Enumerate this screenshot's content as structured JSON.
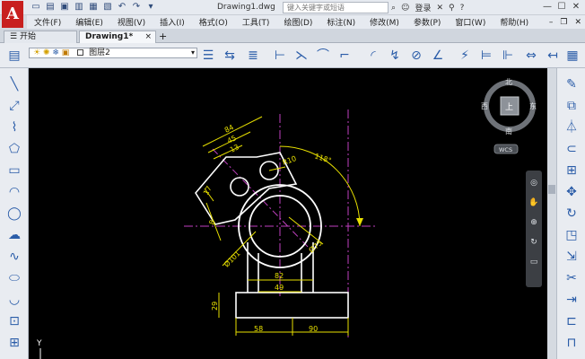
{
  "app": {
    "logo": "A",
    "doc_title": "Drawing1.dwg",
    "search_placeholder": "键入关键字或短语",
    "login": "登录"
  },
  "menu": [
    "文件(F)",
    "编辑(E)",
    "视图(V)",
    "插入(I)",
    "格式(O)",
    "工具(T)",
    "绘图(D)",
    "标注(N)",
    "修改(M)",
    "参数(P)",
    "窗口(W)",
    "帮助(H)"
  ],
  "tabs": {
    "start": "开始",
    "drawing": "Drawing1*",
    "close": "×",
    "add": "+"
  },
  "layer": {
    "name": "图层2",
    "color": "#ffffff"
  },
  "viewcube": {
    "north": "北",
    "south": "南",
    "east": "东",
    "west": "西",
    "top": "上",
    "wcs": "WCS"
  },
  "ucs": {
    "y_label": "Y"
  },
  "drawing": {
    "dims": {
      "d84": "84",
      "d45": "45",
      "d13": "13",
      "d17": "17",
      "d8": "8",
      "r10": "R10",
      "a118": "118°",
      "dia101": "Ø101",
      "dia75": "Ø75",
      "d82": "82",
      "d49": "49",
      "d29": "29",
      "d58": "58",
      "d90": "90"
    }
  },
  "colors": {
    "canvas": "#000000",
    "dim": "#e8e000",
    "center": "#c040c0",
    "geometry": "#ffffff",
    "logo": "#c8201f"
  }
}
